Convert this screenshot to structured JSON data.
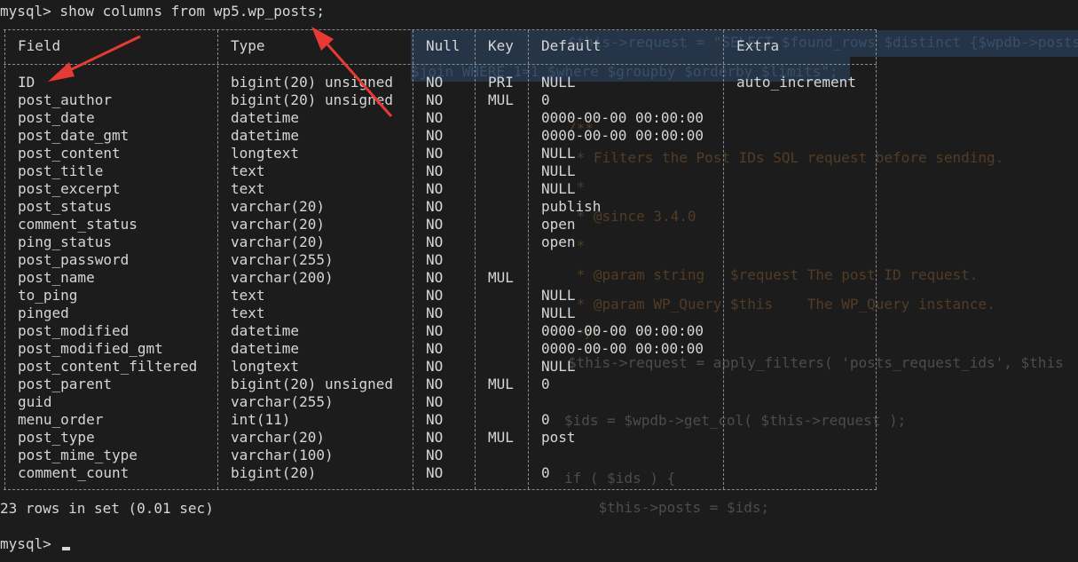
{
  "terminal": {
    "command_prompt": "mysql> show columns from wp5.wp_posts;",
    "result_summary": "23 rows in set (0.01 sec)",
    "final_prompt": "mysql> "
  },
  "table": {
    "headers": [
      "Field",
      "Type",
      "Null",
      "Key",
      "Default",
      "Extra"
    ],
    "rows": [
      {
        "field": "ID",
        "type": "bigint(20) unsigned",
        "null": "NO",
        "key": "PRI",
        "default": "NULL",
        "extra": "auto_increment"
      },
      {
        "field": "post_author",
        "type": "bigint(20) unsigned",
        "null": "NO",
        "key": "MUL",
        "default": "0",
        "extra": ""
      },
      {
        "field": "post_date",
        "type": "datetime",
        "null": "NO",
        "key": "",
        "default": "0000-00-00 00:00:00",
        "extra": ""
      },
      {
        "field": "post_date_gmt",
        "type": "datetime",
        "null": "NO",
        "key": "",
        "default": "0000-00-00 00:00:00",
        "extra": ""
      },
      {
        "field": "post_content",
        "type": "longtext",
        "null": "NO",
        "key": "",
        "default": "NULL",
        "extra": ""
      },
      {
        "field": "post_title",
        "type": "text",
        "null": "NO",
        "key": "",
        "default": "NULL",
        "extra": ""
      },
      {
        "field": "post_excerpt",
        "type": "text",
        "null": "NO",
        "key": "",
        "default": "NULL",
        "extra": ""
      },
      {
        "field": "post_status",
        "type": "varchar(20)",
        "null": "NO",
        "key": "",
        "default": "publish",
        "extra": ""
      },
      {
        "field": "comment_status",
        "type": "varchar(20)",
        "null": "NO",
        "key": "",
        "default": "open",
        "extra": ""
      },
      {
        "field": "ping_status",
        "type": "varchar(20)",
        "null": "NO",
        "key": "",
        "default": "open",
        "extra": ""
      },
      {
        "field": "post_password",
        "type": "varchar(255)",
        "null": "NO",
        "key": "",
        "default": "",
        "extra": ""
      },
      {
        "field": "post_name",
        "type": "varchar(200)",
        "null": "NO",
        "key": "MUL",
        "default": "",
        "extra": ""
      },
      {
        "field": "to_ping",
        "type": "text",
        "null": "NO",
        "key": "",
        "default": "NULL",
        "extra": ""
      },
      {
        "field": "pinged",
        "type": "text",
        "null": "NO",
        "key": "",
        "default": "NULL",
        "extra": ""
      },
      {
        "field": "post_modified",
        "type": "datetime",
        "null": "NO",
        "key": "",
        "default": "0000-00-00 00:00:00",
        "extra": ""
      },
      {
        "field": "post_modified_gmt",
        "type": "datetime",
        "null": "NO",
        "key": "",
        "default": "0000-00-00 00:00:00",
        "extra": ""
      },
      {
        "field": "post_content_filtered",
        "type": "longtext",
        "null": "NO",
        "key": "",
        "default": "NULL",
        "extra": ""
      },
      {
        "field": "post_parent",
        "type": "bigint(20) unsigned",
        "null": "NO",
        "key": "MUL",
        "default": "0",
        "extra": ""
      },
      {
        "field": "guid",
        "type": "varchar(255)",
        "null": "NO",
        "key": "",
        "default": "",
        "extra": ""
      },
      {
        "field": "menu_order",
        "type": "int(11)",
        "null": "NO",
        "key": "",
        "default": "0",
        "extra": ""
      },
      {
        "field": "post_type",
        "type": "varchar(20)",
        "null": "NO",
        "key": "MUL",
        "default": "post",
        "extra": ""
      },
      {
        "field": "post_mime_type",
        "type": "varchar(100)",
        "null": "NO",
        "key": "",
        "default": "",
        "extra": ""
      },
      {
        "field": "comment_count",
        "type": "bigint(20)",
        "null": "NO",
        "key": "",
        "default": "0",
        "extra": ""
      }
    ]
  },
  "background_code": [
    "$this->request = \"SELECT $found_rows $distinct {$wpdb->posts}",
    "$join WHERE 1=1 $where $groupby $orderby $limits\";",
    "/**",
    " * Filters the Post IDs SQL request before sending.",
    " *",
    " * @since 3.4.0",
    " *",
    " * @param string   $request The post ID request.",
    " * @param WP_Query $this    The WP_Query instance.",
    " */",
    "$this->request = apply_filters( 'posts_request_ids', $this",
    "$ids = $wpdb->get_col( $this->request );",
    "if ( $ids ) {",
    "    $this->posts = $ids;"
  ],
  "annotation_color": "#e83a33"
}
